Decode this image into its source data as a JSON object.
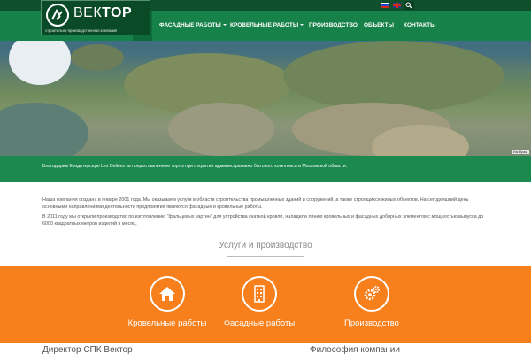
{
  "topbar": {
    "languages": [
      "ru-flag-icon",
      "en-flag-icon"
    ],
    "search_icon": "search-icon"
  },
  "logo": {
    "name_regular": "ВЕК",
    "name_bold": "ТОР",
    "tagline": "строительно-производственная компания"
  },
  "nav": {
    "home_icon": "home-icon",
    "items": [
      {
        "label": "ФАСАДНЫЕ РАБОТЫ",
        "dropdown": true
      },
      {
        "label": "КРОВЕЛЬНЫЕ РАБОТЫ",
        "dropdown": true
      },
      {
        "label": "ПРОИЗВОДСТВО",
        "dropdown": false
      },
      {
        "label": "ОБЪЕКТЫ",
        "dropdown": false
      },
      {
        "label": "КОНТАКТЫ",
        "dropdown": false
      }
    ]
  },
  "hero": {
    "credit": "Изображ"
  },
  "caption": "Благодарим Кондитерскую Les Delices за предоставленные торты при открытии административно бытового комплекса в Московской области.",
  "intro": {
    "p1": "Наша компания создана в январе 2001 года. Мы оказываем услуги в области строительства промышленных зданий и сооружений, а также строящихся жилых объектов. На сегодняшний день основными направлениями деятельности предприятия являются фасадные и кровельные работы.",
    "p2": "В 2011 году мы открыли производство по изготовлению \"фальцевых картин\" для устройства скатной кровли, наладили линию кровельных и фасадных доборных элементов с мощностью выпуска до 6000 квадратных метров изделий в месяц."
  },
  "section_title": "Услуги и производство",
  "services": [
    {
      "label": "Кровельные работы",
      "icon": "home-icon"
    },
    {
      "label": "Фасадные работы",
      "icon": "building-icon"
    },
    {
      "label": "Производство",
      "icon": "gears-icon"
    }
  ],
  "footer": {
    "left_heading": "Директор СПК Вектор",
    "right_heading": "Философия компании"
  },
  "colors": {
    "nav_green": "#17814a",
    "dark_green": "#0b4a27",
    "orange": "#f7801c"
  }
}
